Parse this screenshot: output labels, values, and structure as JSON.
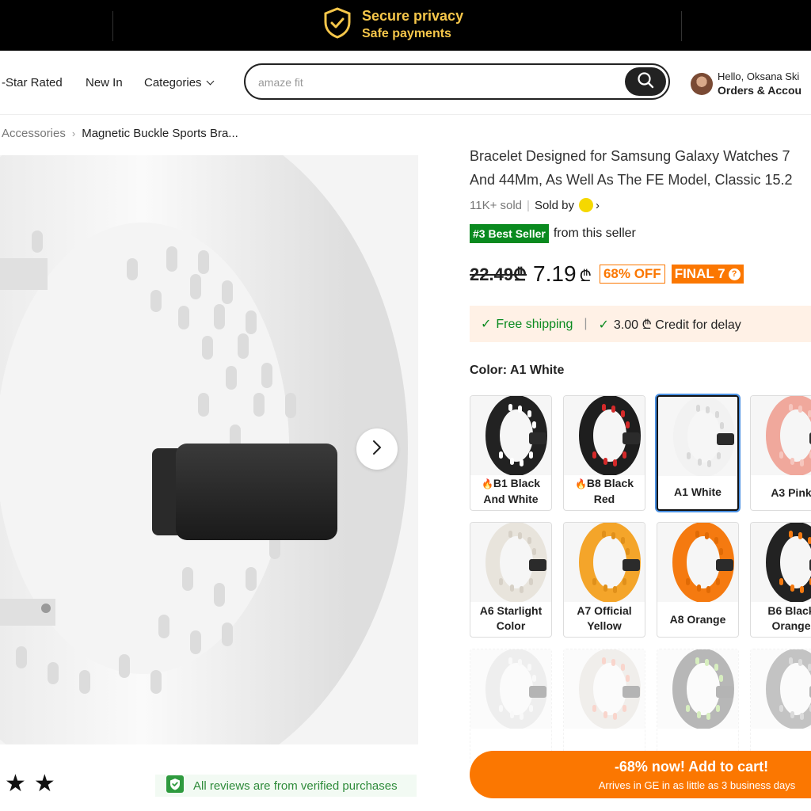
{
  "banner": {
    "title": "Secure privacy",
    "subtitle": "Safe payments",
    "icon": "shield-check-icon",
    "text_color": "#f5c64a"
  },
  "nav": {
    "items": [
      {
        "label": "-Star Rated"
      },
      {
        "label": "New In"
      },
      {
        "label": "Categories"
      }
    ],
    "search": {
      "value": "amaze fit"
    },
    "account": {
      "hello": "Hello, Oksana Ski",
      "orders": "Orders & Accou"
    }
  },
  "breadcrumb": {
    "items": [
      "Accessories",
      "Magnetic Buckle Sports Bra..."
    ]
  },
  "product": {
    "title_line1": "Bracelet Designed for Samsung Galaxy Watches 7",
    "title_line2": "And 44Mm, As Well As The FE Model, Classic 15.2",
    "sold": "11K+ sold",
    "sold_by": "Sold by",
    "best_seller": "#3 Best Seller",
    "best_seller_suffix": "from this seller",
    "old_price": "22.49₾",
    "new_price": "7.19",
    "currency": "₾",
    "off": "68% OFF",
    "final": "FINAL 7",
    "shipping_free": "Free shipping",
    "shipping_credit": "3.00 ₾ Credit for delay",
    "color_label": "Color: A1 White",
    "accent": "#fb7701",
    "green": "#0a8a1f"
  },
  "swatches": [
    {
      "name": "B1 Black And White",
      "line1": "B1 Black",
      "line2": "And White",
      "hot": true,
      "band": "#222222",
      "holes": "#ffffff",
      "selected": false,
      "faded": false
    },
    {
      "name": "B8 Black Red",
      "line1": "B8 Black",
      "line2": "Red",
      "hot": true,
      "band": "#1e1e1e",
      "holes": "#d42a2a",
      "selected": false,
      "faded": false
    },
    {
      "name": "A1 White",
      "line1": "A1 White",
      "line2": "",
      "hot": false,
      "band": "#f2f2f2",
      "holes": "#d8d8d8",
      "selected": true,
      "faded": false
    },
    {
      "name": "A3 Pink",
      "line1": "A3 Pink",
      "line2": "",
      "hot": false,
      "band": "#f0a89c",
      "holes": "#f6c6be",
      "selected": false,
      "faded": false
    },
    {
      "name": "A6 Starlight Color",
      "line1": "A6 Starlight",
      "line2": "Color",
      "hot": false,
      "band": "#e8e4dc",
      "holes": "#d6d0c6",
      "selected": false,
      "faded": false
    },
    {
      "name": "A7 Official Yellow",
      "line1": "A7 Official",
      "line2": "Yellow",
      "hot": false,
      "band": "#f4a52a",
      "holes": "#e0901a",
      "selected": false,
      "faded": false
    },
    {
      "name": "A8 Orange",
      "line1": "A8 Orange",
      "line2": "",
      "hot": false,
      "band": "#f57a10",
      "holes": "#e06a05",
      "selected": false,
      "faded": false
    },
    {
      "name": "B6 Black Orange",
      "line1": "B6 Black",
      "line2": "Orange",
      "hot": false,
      "band": "#222222",
      "holes": "#f57a10",
      "selected": false,
      "faded": false
    },
    {
      "name": "",
      "line1": "",
      "line2": "",
      "hot": false,
      "band": "#cfcfcf",
      "holes": "#eeeeee",
      "selected": false,
      "faded": true
    },
    {
      "name": "",
      "line1": "",
      "line2": "",
      "hot": false,
      "band": "#d6cfc8",
      "holes": "#ee8a70",
      "selected": false,
      "faded": true
    },
    {
      "name": "",
      "line1": "",
      "line2": "",
      "hot": false,
      "band": "#333333",
      "holes": "#8ed04a",
      "selected": false,
      "faded": true
    },
    {
      "name": "",
      "line1": "",
      "line2": "",
      "hot": false,
      "band": "#555555",
      "holes": "#9a9a9a",
      "selected": false,
      "faded": true
    }
  ],
  "reviews": {
    "stars": 2,
    "verified_text": "All reviews are from verified purchases"
  },
  "cart": {
    "label": "-68% now! Add to cart!",
    "sub": "Arrives in GE in as little as 3 business days"
  }
}
